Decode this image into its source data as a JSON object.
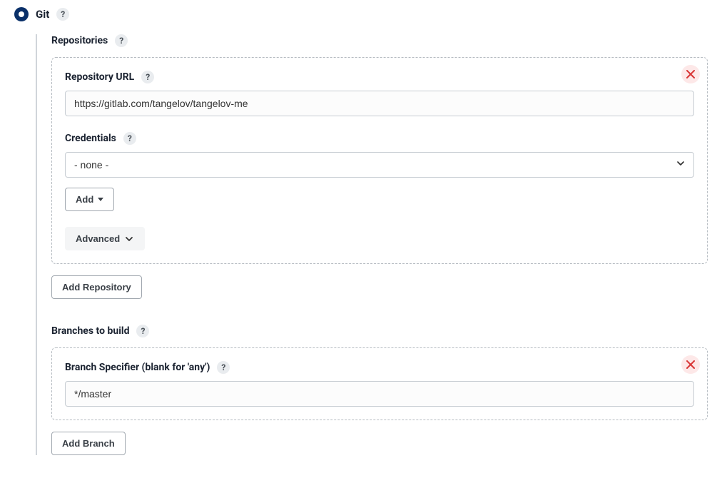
{
  "scm": {
    "git_label": "Git"
  },
  "repositories": {
    "heading": "Repositories",
    "repo": {
      "url_label": "Repository URL",
      "url_value": "https://gitlab.com/tangelov/tangelov-me",
      "credentials_label": "Credentials",
      "credentials_value": "- none -",
      "add_label": "Add",
      "advanced_label": "Advanced"
    },
    "add_repo_label": "Add Repository"
  },
  "branches": {
    "heading": "Branches to build",
    "specifier_label": "Branch Specifier (blank for 'any')",
    "specifier_value": "*/master",
    "add_branch_label": "Add Branch"
  },
  "glyphs": {
    "help": "?"
  }
}
